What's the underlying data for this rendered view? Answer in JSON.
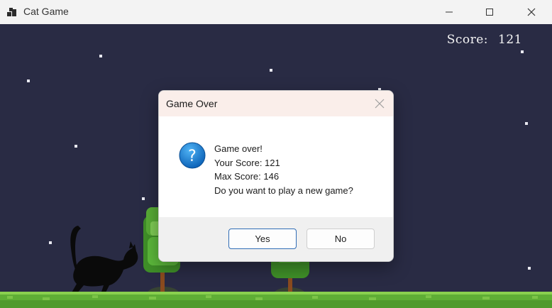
{
  "window": {
    "title": "Cat Game",
    "icon": "app-icon",
    "controls": [
      "minimize-icon",
      "maximize-icon",
      "close-icon"
    ]
  },
  "game": {
    "score_label": "Score:",
    "score_value": "121"
  },
  "dialog": {
    "title": "Game Over",
    "icon": "question-icon",
    "lines": [
      "Game over!",
      "Your Score: 121",
      "Max Score: 146",
      "Do you want to play a new game?"
    ],
    "yes_label": "Yes",
    "no_label": "No"
  },
  "colors": {
    "sky": "#292b44",
    "grass": "#5fae35",
    "dialog_title_bg": "#faeeea",
    "accent_border": "#2f6cb5"
  }
}
